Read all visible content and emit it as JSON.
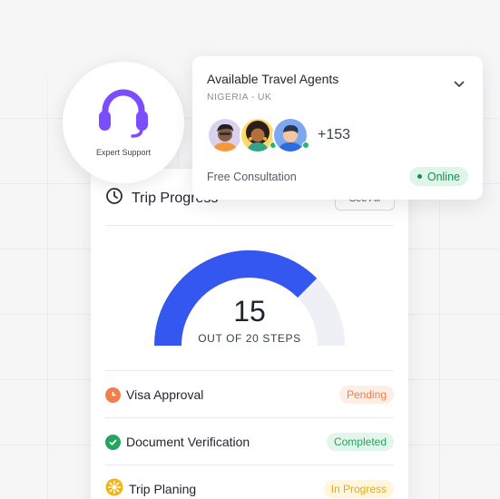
{
  "support": {
    "label": "Expert Support",
    "icon": "headset-icon",
    "accent": "#7c4dff"
  },
  "agents": {
    "title": "Available Travel Agents",
    "subtitle": "NIGERIA - UK",
    "more_count": "+153",
    "consultation": "Free Consultation",
    "status": "Online"
  },
  "progress": {
    "title": "Trip Progress",
    "see_all": "See All",
    "completed": 15,
    "total": 20,
    "value_text": "15",
    "caption": "OUT OF 20 STEPS",
    "accent": "#3457f0"
  },
  "steps": [
    {
      "label": "Visa Approval",
      "status": "Pending",
      "icon": "clock-icon",
      "color": "#ef7f4e"
    },
    {
      "label": "Document Verification",
      "status": "Completed",
      "icon": "check-circle-icon",
      "color": "#26a45f"
    },
    {
      "label": "Trip Planing",
      "status": "In Progress",
      "icon": "sun-icon",
      "color": "#f5b317"
    }
  ]
}
